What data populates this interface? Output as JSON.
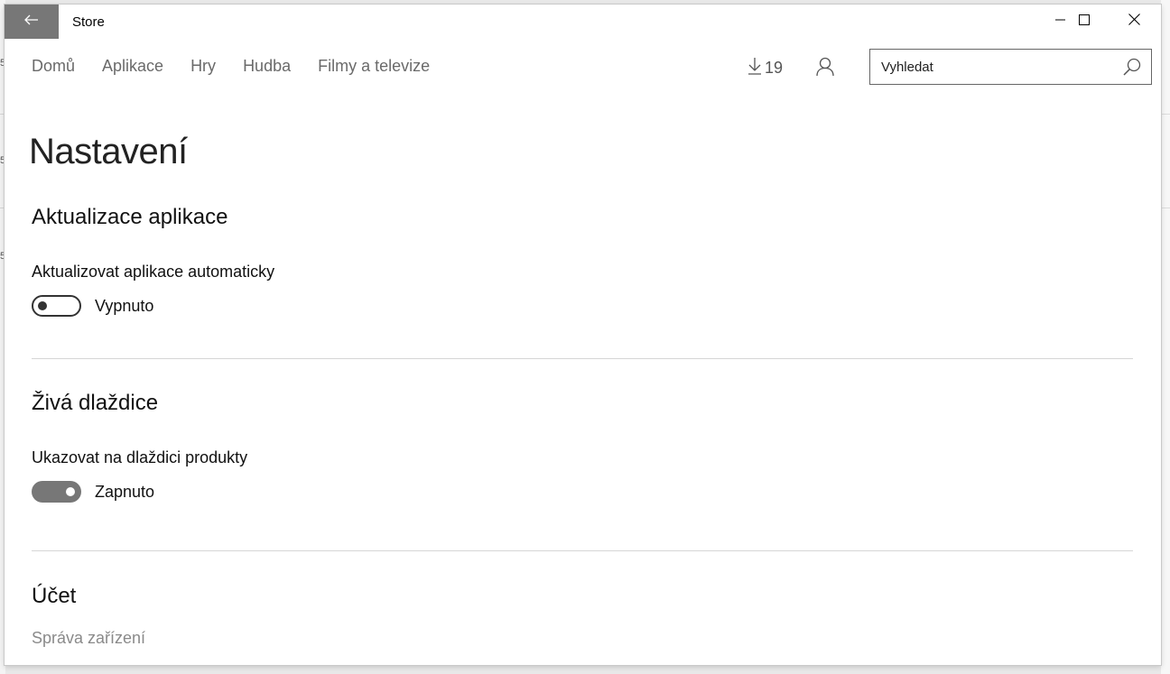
{
  "window": {
    "title": "Store"
  },
  "nav": {
    "items": [
      "Domů",
      "Aplikace",
      "Hry",
      "Hudba",
      "Filmy a televize"
    ],
    "downloads_count": "19"
  },
  "search": {
    "placeholder": "Vyhledat"
  },
  "page": {
    "title": "Nastavení"
  },
  "sections": {
    "app_updates": {
      "title": "Aktualizace aplikace",
      "setting_label": "Aktualizovat aplikace automaticky",
      "toggle_state": "Vypnuto",
      "is_on": false
    },
    "live_tile": {
      "title": "Živá dlaždice",
      "setting_label": "Ukazovat na dlaždici produkty",
      "toggle_state": "Zapnuto",
      "is_on": true
    },
    "account": {
      "title": "Účet",
      "link": "Správa zařízení"
    }
  },
  "icons": {
    "back": "back-arrow-icon",
    "minimize": "minimize-icon",
    "maximize": "maximize-icon",
    "close": "close-icon",
    "download": "download-icon",
    "user": "user-icon",
    "search": "search-icon"
  },
  "colors": {
    "back_button_bg": "#777777",
    "toggle_on_bg": "#777777",
    "nav_text": "#6a6a6a"
  }
}
